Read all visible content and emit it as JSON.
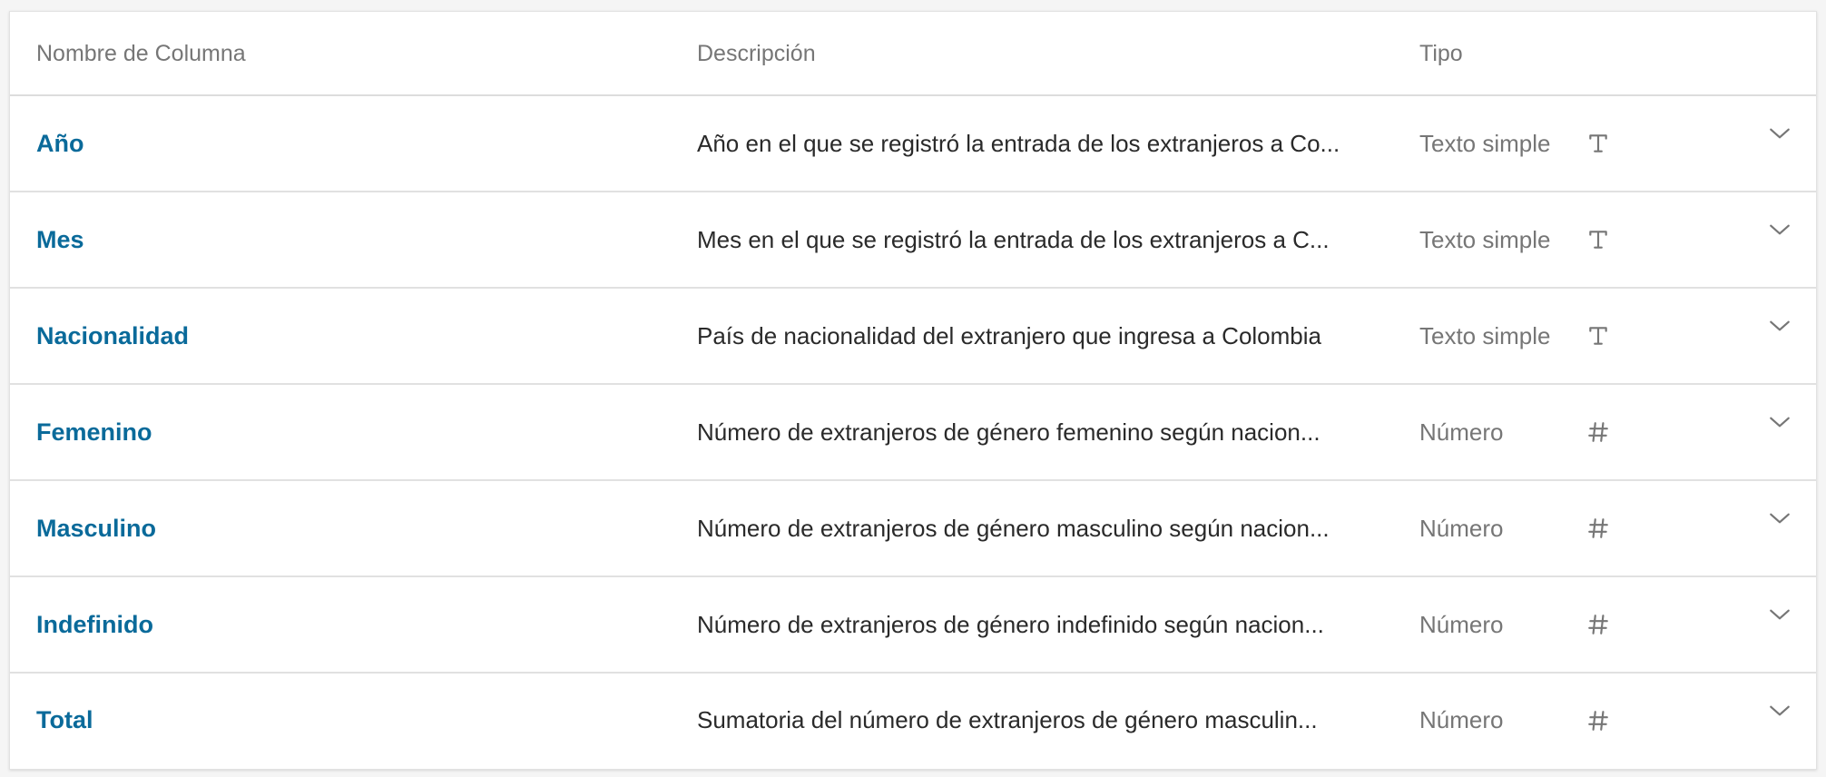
{
  "header": {
    "name_label": "Nombre de Columna",
    "description_label": "Descripción",
    "type_label": "Tipo"
  },
  "rows": [
    {
      "name": "Año",
      "description": "Año en el que se registró la entrada de los extranjeros a Co...",
      "type": "Texto simple",
      "type_icon": "text-type-icon"
    },
    {
      "name": "Mes",
      "description": "Mes en el que se registró la entrada de los extranjeros a C...",
      "type": "Texto simple",
      "type_icon": "text-type-icon"
    },
    {
      "name": "Nacionalidad",
      "description": "País de nacionalidad del extranjero que ingresa a Colombia",
      "type": "Texto simple",
      "type_icon": "text-type-icon"
    },
    {
      "name": "Femenino",
      "description": "Número de extranjeros de género femenino según nacion...",
      "type": "Número",
      "type_icon": "number-type-icon"
    },
    {
      "name": "Masculino",
      "description": "Número de extranjeros de género masculino según nacion...",
      "type": "Número",
      "type_icon": "number-type-icon"
    },
    {
      "name": "Indefinido",
      "description": "Número de extranjeros de género indefinido según nacion...",
      "type": "Número",
      "type_icon": "number-type-icon"
    },
    {
      "name": "Total",
      "description": "Sumatoria del número de extranjeros de género masculin...",
      "type": "Número",
      "type_icon": "number-type-icon"
    }
  ],
  "colors": {
    "link": "#0a6a9a",
    "muted": "#767676",
    "text": "#2a2a2a"
  }
}
